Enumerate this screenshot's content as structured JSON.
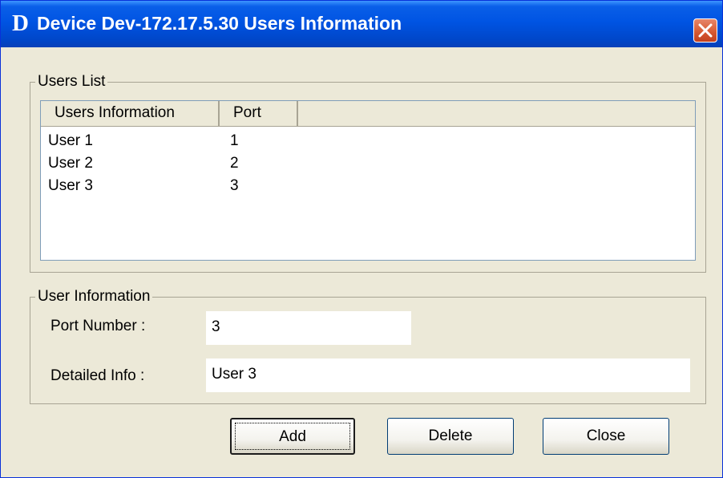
{
  "window": {
    "logo_letter": "D",
    "title": "Device Dev-172.17.5.30 Users Information",
    "close_glyph": "✕",
    "title_bar_color": "#0054e3",
    "close_button_color": "#d85b33"
  },
  "users_list": {
    "legend": "Users List",
    "columns": [
      "Users Information",
      "Port"
    ],
    "rows": [
      {
        "info": "User 1",
        "port": "1"
      },
      {
        "info": "User 2",
        "port": "2"
      },
      {
        "info": "User 3",
        "port": "3"
      }
    ]
  },
  "user_information": {
    "legend": "User Information",
    "port_number_label": "Port Number :",
    "port_number_value": "3",
    "detailed_info_label": "Detailed Info :",
    "detailed_info_value": "User 3"
  },
  "buttons": {
    "add": "Add",
    "delete": "Delete",
    "close": "Close"
  },
  "icons": {
    "logo": "dlink-d-logo-icon",
    "close": "close-icon"
  }
}
